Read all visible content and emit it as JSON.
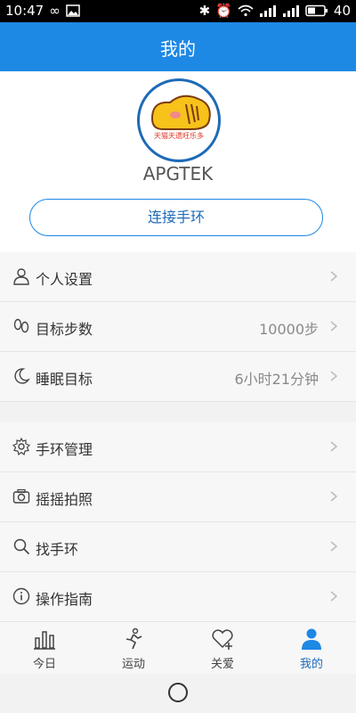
{
  "status": {
    "time": "10:47",
    "battery": "40"
  },
  "header": {
    "title": "我的"
  },
  "profile": {
    "avatar_caption": "天猫天遗旺乐多",
    "username": "APGTEK",
    "connect_label": "连接手环"
  },
  "settings_group1": [
    {
      "label": "个人设置",
      "value": "",
      "icon": "person-icon"
    },
    {
      "label": "目标步数",
      "value": "10000步",
      "icon": "footprints-icon"
    },
    {
      "label": "睡眠目标",
      "value": "6小时21分钟",
      "icon": "moon-icon"
    }
  ],
  "settings_group2": [
    {
      "label": "手环管理",
      "icon": "gear-icon"
    },
    {
      "label": "摇摇拍照",
      "icon": "camera-icon"
    },
    {
      "label": "找手环",
      "icon": "search-icon"
    },
    {
      "label": "操作指南",
      "icon": "info-icon"
    }
  ],
  "bottom_nav": [
    {
      "label": "今日",
      "icon": "bar-chart-icon"
    },
    {
      "label": "运动",
      "icon": "runner-icon"
    },
    {
      "label": "关爱",
      "icon": "heart-plus-icon"
    },
    {
      "label": "我的",
      "icon": "person-filled-icon",
      "active": true
    }
  ],
  "colors": {
    "accent": "#1e88e5",
    "accent_dark": "#1e6ab8"
  }
}
